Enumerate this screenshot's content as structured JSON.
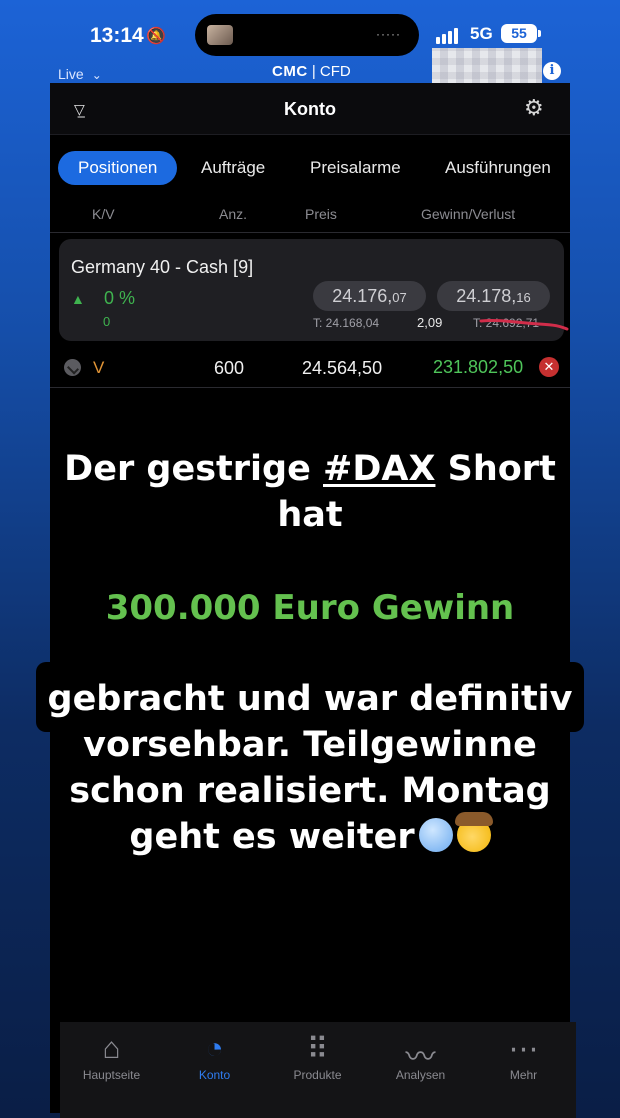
{
  "status_bar": {
    "time": "13:14",
    "network": "5G",
    "battery": "55"
  },
  "top_bar": {
    "mode": "Live",
    "brand": "CMC",
    "brand_suffix": "| CFD"
  },
  "app": {
    "header_title": "Konto",
    "tabs": [
      "Positionen",
      "Aufträge",
      "Preisalarme",
      "Ausführungen"
    ],
    "columns": [
      "K/V",
      "Anz.",
      "Preis",
      "Gewinn/Verlust"
    ],
    "instrument": {
      "name": "Germany 40 - Cash [9]",
      "change_pct": "0 %",
      "change_abs": "0",
      "sell_price_main": "24.176,",
      "sell_price_small": "07",
      "buy_price_main": "24.178,",
      "buy_price_small": "16",
      "low": "T: 24.168,04",
      "spread": "2,09",
      "high": "T: 24.692,71"
    },
    "position": {
      "direction": "V",
      "quantity": "600",
      "price": "24.564,50",
      "profit_loss": "231.802,50"
    }
  },
  "overlay": {
    "line1_pre": "Der gestrige ",
    "hashtag": "#DAX",
    "line1_post": " Short",
    "line2": "hat",
    "highlight": "300.000 Euro Gewinn",
    "body_lines": [
      "gebracht und war definitiv",
      "vorsehbar. Teilgewinne",
      "schon realisiert. Montag",
      "geht es weiter"
    ]
  },
  "bottom_nav": [
    {
      "label": "Hauptseite",
      "icon": "home-icon"
    },
    {
      "label": "Konto",
      "icon": "clock-icon"
    },
    {
      "label": "Produkte",
      "icon": "grid-search-icon"
    },
    {
      "label": "Analysen",
      "icon": "pulse-icon"
    },
    {
      "label": "Mehr",
      "icon": "more-icon"
    }
  ],
  "colors": {
    "accent": "#1c6ae0",
    "profit": "#4fc55a",
    "sell_direction": "#e09436"
  }
}
